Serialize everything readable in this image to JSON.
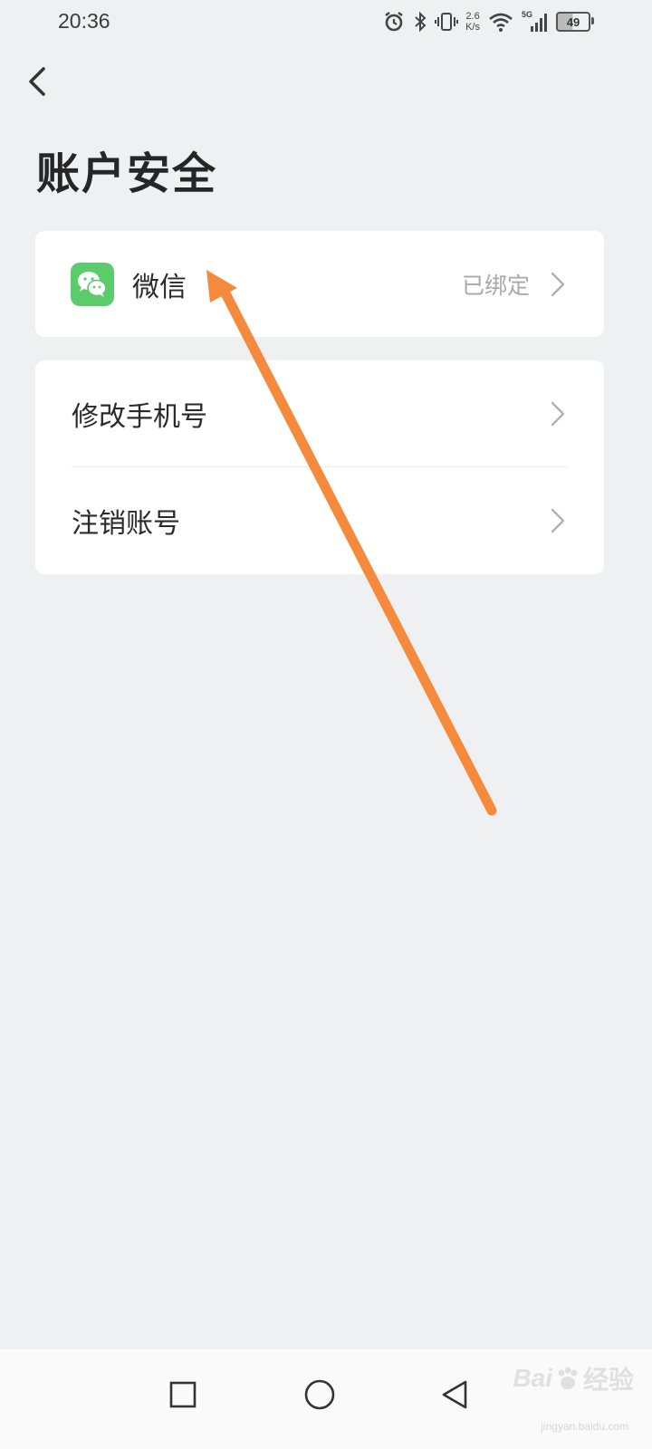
{
  "status_bar": {
    "time": "20:36",
    "net_speed_value": "2.6",
    "net_speed_unit": "K/s",
    "network_type": "5G",
    "battery_level": "49",
    "icons": [
      "alarm-icon",
      "bluetooth-icon",
      "vibrate-icon",
      "wifi-icon",
      "signal-icon",
      "battery-icon"
    ]
  },
  "header": {
    "title": "账户安全"
  },
  "sections": {
    "wechat": {
      "label": "微信",
      "value": "已绑定",
      "icon": "wechat-icon",
      "icon_color": "#5ccb6c"
    },
    "account": {
      "change_phone_label": "修改手机号",
      "cancel_account_label": "注销账号"
    }
  },
  "annotation": {
    "color": "#f58a3c"
  },
  "nav_bar": {
    "buttons": [
      "recent-apps-button",
      "home-button",
      "back-nav-button"
    ]
  },
  "watermark": {
    "brand": "Bai",
    "brand_tail": "经验",
    "url": "jingyan.baidu.com"
  }
}
